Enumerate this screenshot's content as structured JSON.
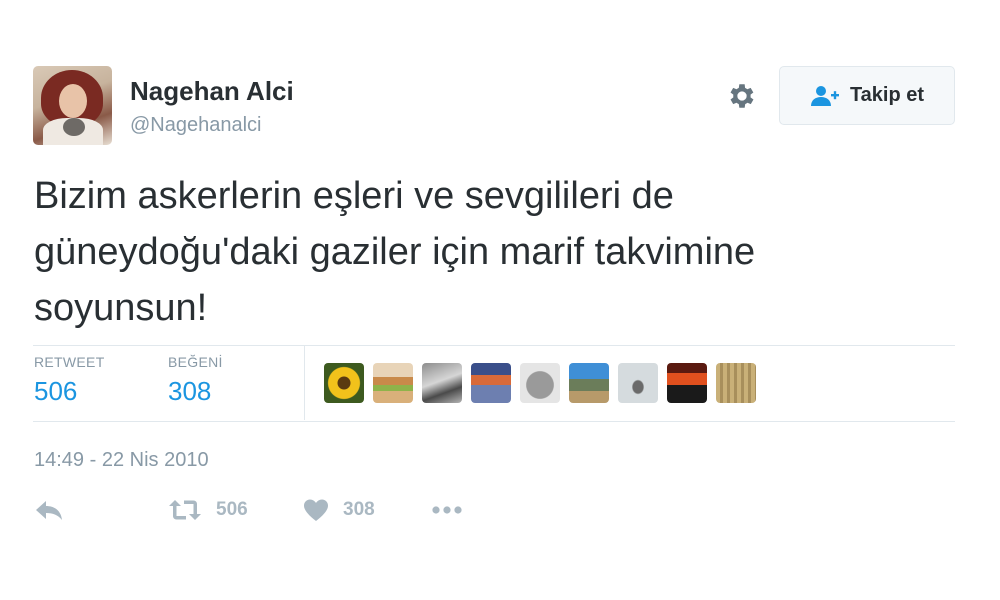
{
  "user": {
    "name": "Nagehan Alci",
    "handle": "@Nagehanalci"
  },
  "follow_button": {
    "label": "Takip et",
    "icon": "add-user-icon"
  },
  "settings": {
    "icon": "gear-icon"
  },
  "tweet": {
    "lines": [
      "Bizim askerlerin eşleri ve sevgilileri de",
      "güneydoğu'daki gaziler için marif takvimine",
      "soyunsun!"
    ]
  },
  "stats": {
    "retweets": {
      "label": "RETWEET",
      "value": "506"
    },
    "likes": {
      "label": "BEĞENİ",
      "value": "308"
    }
  },
  "liker_avatars": [
    {
      "icon": "sunflower-avatar"
    },
    {
      "icon": "food-avatar"
    },
    {
      "icon": "gray-landscape-avatar"
    },
    {
      "icon": "sunset-avatar"
    },
    {
      "icon": "cat-avatar"
    },
    {
      "icon": "landscape-avatar"
    },
    {
      "icon": "rock-avatar"
    },
    {
      "icon": "red-sunset-avatar"
    },
    {
      "icon": "texture-avatar"
    }
  ],
  "timestamp": "14:49 - 22 Nis 2010",
  "actions": {
    "reply": {
      "icon": "reply-icon"
    },
    "retweet": {
      "icon": "retweet-icon",
      "count": "506"
    },
    "like": {
      "icon": "heart-icon",
      "count": "308"
    },
    "more": {
      "icon": "more-icon"
    }
  },
  "colors": {
    "accent": "#1b95e0",
    "muted": "#8899a6",
    "text": "#292f33",
    "action": "#aab8c2"
  }
}
